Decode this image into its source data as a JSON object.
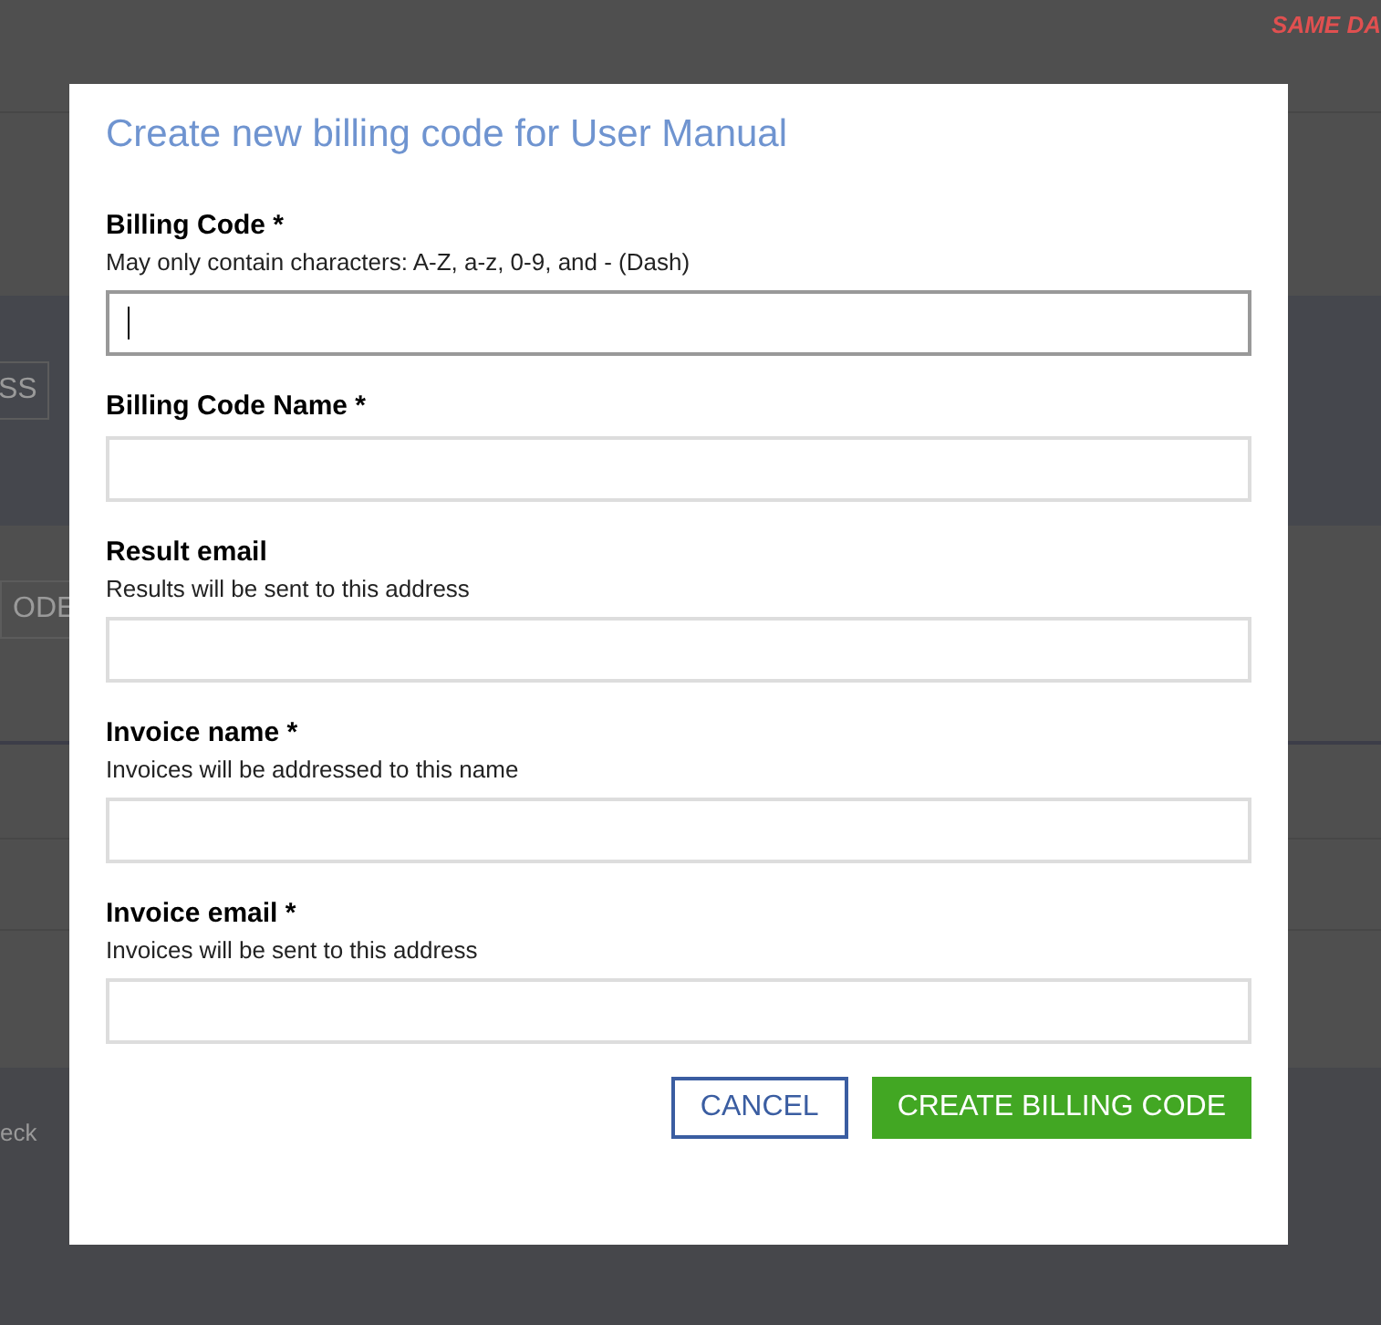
{
  "background": {
    "banner": "SAME DA",
    "button_1": "SS",
    "button_2": "ODE",
    "footer_text": "eck"
  },
  "dialog": {
    "title": "Create new billing code for User Manual",
    "fields": [
      {
        "label": "Billing Code *",
        "hint": "May only contain characters: A-Z, a-z, 0-9, and - (Dash)",
        "focused": true
      },
      {
        "label": "Billing Code Name *",
        "focused": false
      },
      {
        "label": "Result email",
        "hint": "Results will be sent to this address",
        "focused": false
      },
      {
        "label": "Invoice name *",
        "hint": "Invoices will be addressed to this name",
        "focused": false
      },
      {
        "label": "Invoice email *",
        "hint": "Invoices will be sent to this address",
        "focused": false
      }
    ],
    "buttons": [
      {
        "label": "CANCEL",
        "kind": "outline"
      },
      {
        "label": "CREATE BILLING CODE",
        "kind": "primary"
      }
    ]
  }
}
